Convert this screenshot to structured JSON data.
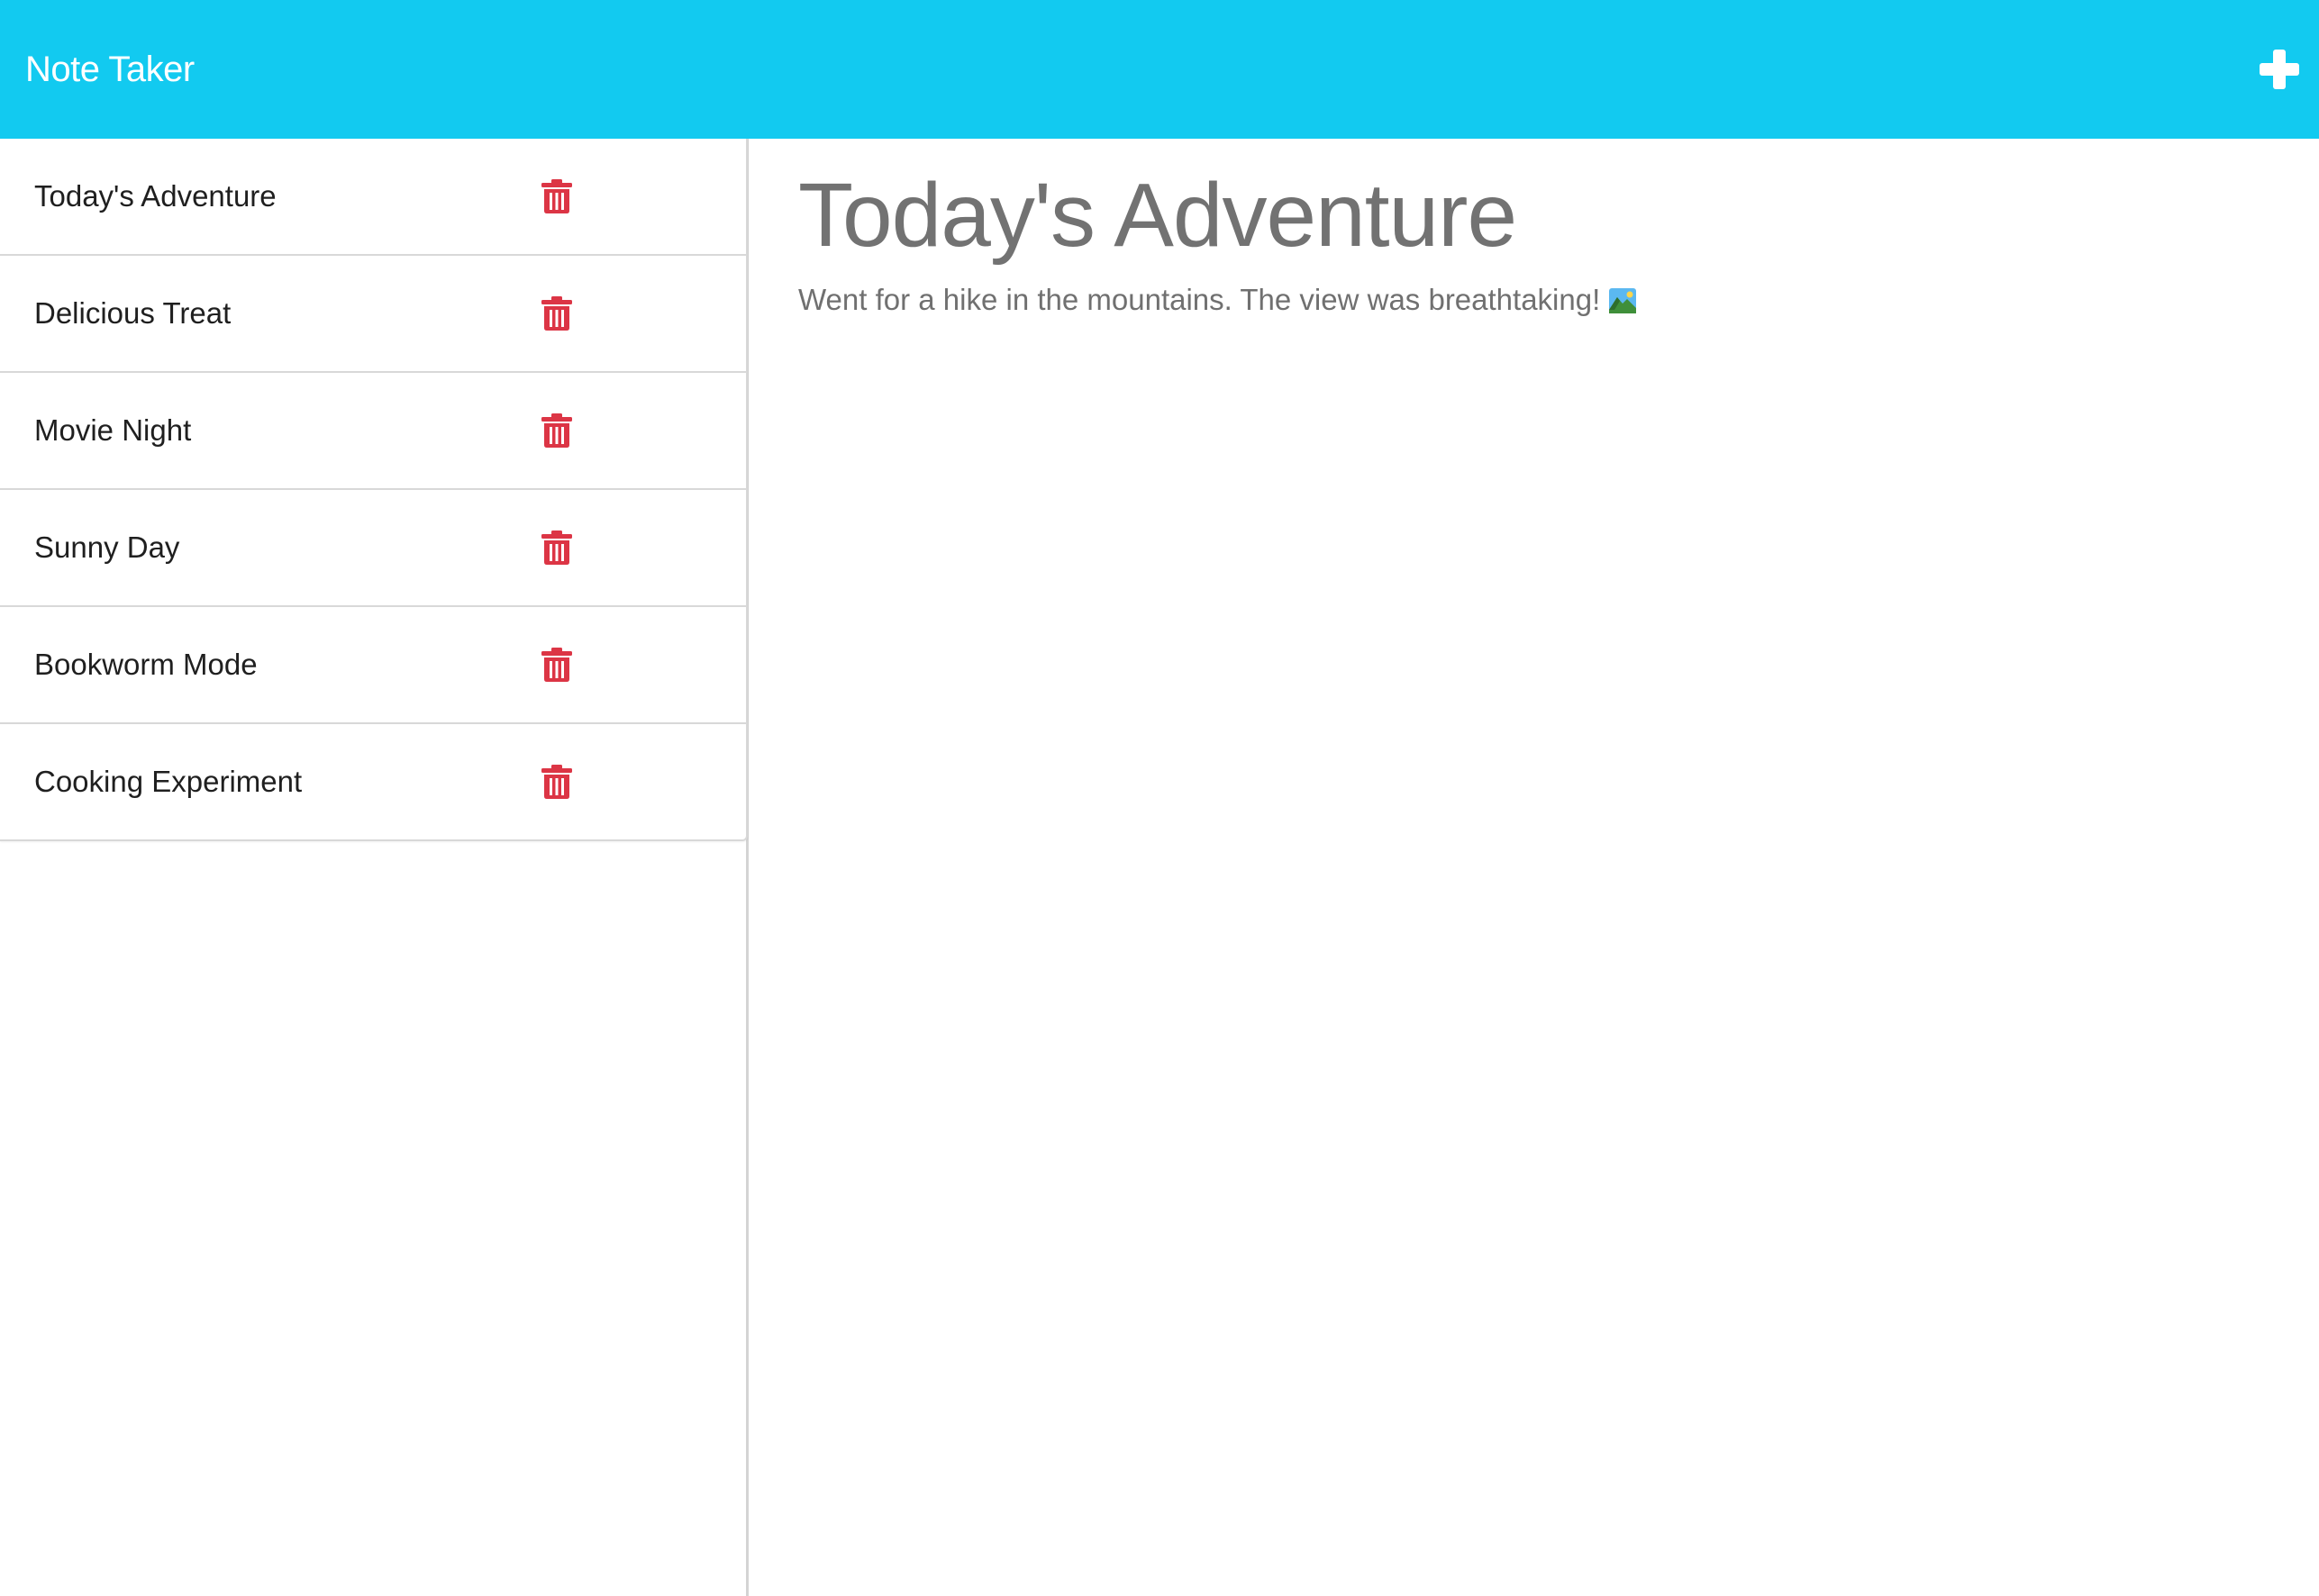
{
  "app": {
    "title": "Note Taker"
  },
  "icons": {
    "new_note": "plus-icon",
    "delete": "trash-icon",
    "emoji": "landscape-icon"
  },
  "colors": {
    "navbar": "#12caf0",
    "delete_icon": "#dc3545",
    "note_text": "#727272"
  },
  "notes": [
    {
      "title": "Today's Adventure"
    },
    {
      "title": "Delicious Treat"
    },
    {
      "title": "Movie Night"
    },
    {
      "title": "Sunny Day"
    },
    {
      "title": "Bookworm Mode"
    },
    {
      "title": "Cooking Experiment"
    }
  ],
  "active_note": {
    "title": "Today's Adventure",
    "text": "Went for a hike in the mountains. The view was breathtaking!"
  }
}
